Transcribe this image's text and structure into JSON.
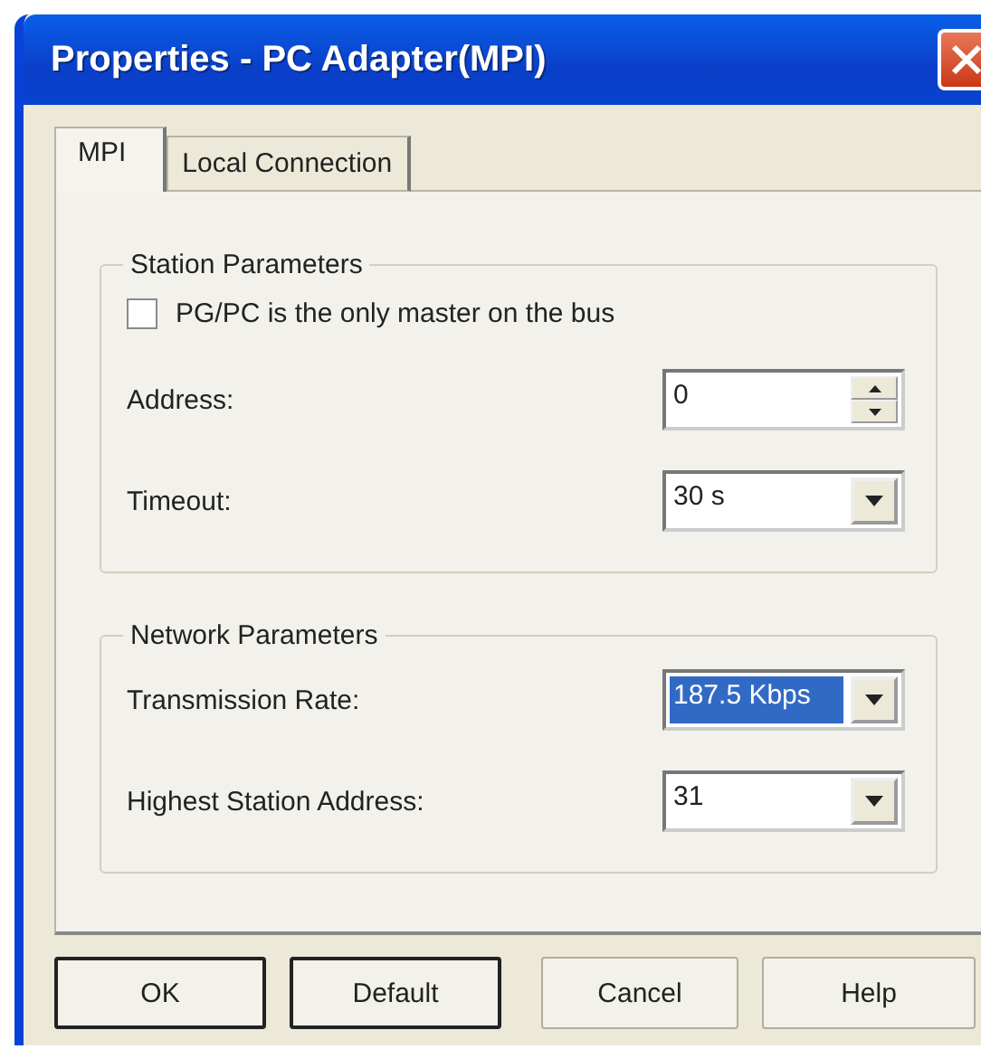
{
  "window": {
    "title": "Properties - PC Adapter(MPI)"
  },
  "tabs": [
    {
      "label": "MPI",
      "selected": true
    },
    {
      "label": "Local Connection",
      "selected": false
    }
  ],
  "groups": [
    {
      "title": "Station Parameters",
      "checkbox": {
        "label": "PG/PC is the only master on the bus",
        "checked": false
      },
      "fields": [
        {
          "kind": "spinner",
          "label": "Address:",
          "value": "0",
          "selected": false
        },
        {
          "kind": "dropdown",
          "label": "Timeout:",
          "value": "30 s",
          "selected": false
        }
      ]
    },
    {
      "title": "Network Parameters",
      "fields": [
        {
          "kind": "dropdown",
          "label": "Transmission Rate:",
          "value": "187.5 Kbps",
          "selected": true
        },
        {
          "kind": "dropdown",
          "label": "Highest Station Address:",
          "value": "31",
          "selected": false
        }
      ]
    }
  ],
  "buttons": [
    {
      "label": "OK",
      "default": true
    },
    {
      "label": "Default",
      "default": true
    },
    {
      "label": "Cancel",
      "default": false
    },
    {
      "label": "Help",
      "default": false
    }
  ]
}
